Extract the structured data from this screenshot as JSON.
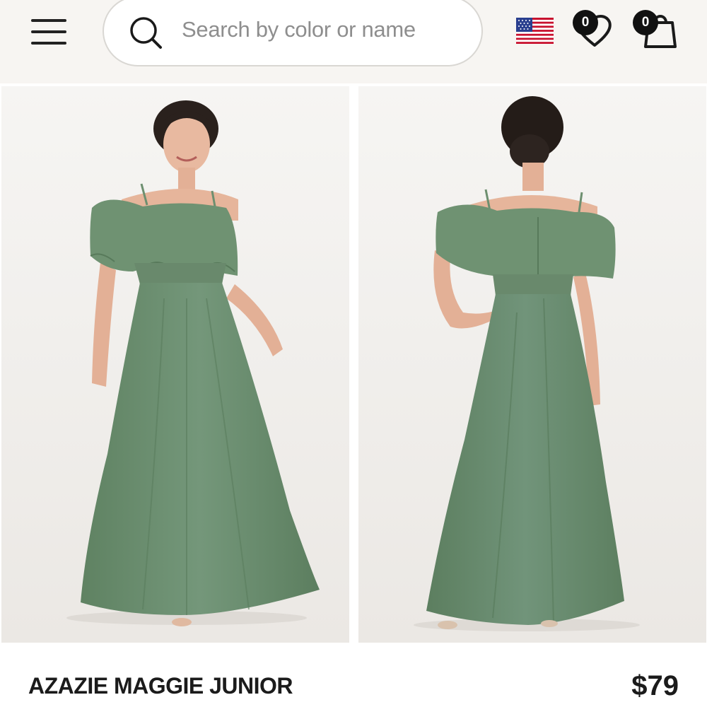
{
  "header": {
    "menu_icon": "hamburger-menu-icon",
    "search": {
      "placeholder": "Search by color or name",
      "icon": "search-icon"
    },
    "region_flag": "us-flag-icon",
    "wishlist": {
      "icon": "heart-icon",
      "count": "0"
    },
    "cart": {
      "icon": "shopping-bag-icon",
      "count": "0"
    }
  },
  "gallery": {
    "images": [
      {
        "view": "front",
        "color": "#6d8f6f"
      },
      {
        "view": "back",
        "color": "#6d8f6f"
      }
    ]
  },
  "product": {
    "title": "AZAZIE MAGGIE JUNIOR",
    "price": "$79"
  },
  "colors": {
    "dress": "#6d8f6f",
    "background": "#f7f5f2",
    "text": "#1b1b1b"
  }
}
